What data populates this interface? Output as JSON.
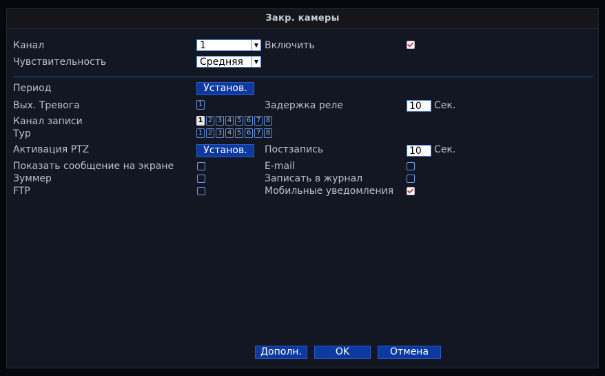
{
  "title": "Закр. камеры",
  "labels": {
    "channel": "Канал",
    "enable": "Включить",
    "sensitivity": "Чувствительность",
    "period": "Период",
    "alarm_out": "Вых. Тревога",
    "relay_delay": "Задержка реле",
    "record_channel": "Канал записи",
    "tour": "Тур",
    "ptz_activation": "Активация PTZ",
    "post_record": "Постзапись",
    "show_message": "Показать сообщение на экране",
    "email": "E-mail",
    "buzzer": "Зуммер",
    "write_log": "Записать в журнал",
    "ftp": "FTP",
    "mobile_notify": "Мобильные уведомления"
  },
  "values": {
    "channel": "1",
    "sensitivity": "Средняя",
    "relay_delay": "10",
    "relay_delay_unit": "Сек.",
    "post_record": "10",
    "post_record_unit": "Сек.",
    "alarm_out_number": "1"
  },
  "checkboxes": {
    "enable": true,
    "show_message": false,
    "email": false,
    "buzzer": false,
    "write_log": false,
    "ftp": false,
    "mobile_notify": true
  },
  "record_channels": [
    {
      "n": "1",
      "on": true
    },
    {
      "n": "2",
      "on": false
    },
    {
      "n": "3",
      "on": false
    },
    {
      "n": "4",
      "on": false
    },
    {
      "n": "5",
      "on": false
    },
    {
      "n": "6",
      "on": false
    },
    {
      "n": "7",
      "on": false
    },
    {
      "n": "8",
      "on": false
    }
  ],
  "tour_channels": [
    {
      "n": "1",
      "on": false
    },
    {
      "n": "2",
      "on": false
    },
    {
      "n": "3",
      "on": false
    },
    {
      "n": "4",
      "on": false
    },
    {
      "n": "5",
      "on": false
    },
    {
      "n": "6",
      "on": false
    },
    {
      "n": "7",
      "on": false
    },
    {
      "n": "8",
      "on": false
    }
  ],
  "buttons": {
    "set": "Установ.",
    "advanced": "Дополн.",
    "ok": "OK",
    "cancel": "Отмена"
  },
  "colors": {
    "accent": "#0d3aa0",
    "separator": "#1d5fae",
    "check": "#e03a4a"
  },
  "icons": {
    "dropdown": "chevron-down-icon",
    "checkmark": "checkmark-icon"
  }
}
